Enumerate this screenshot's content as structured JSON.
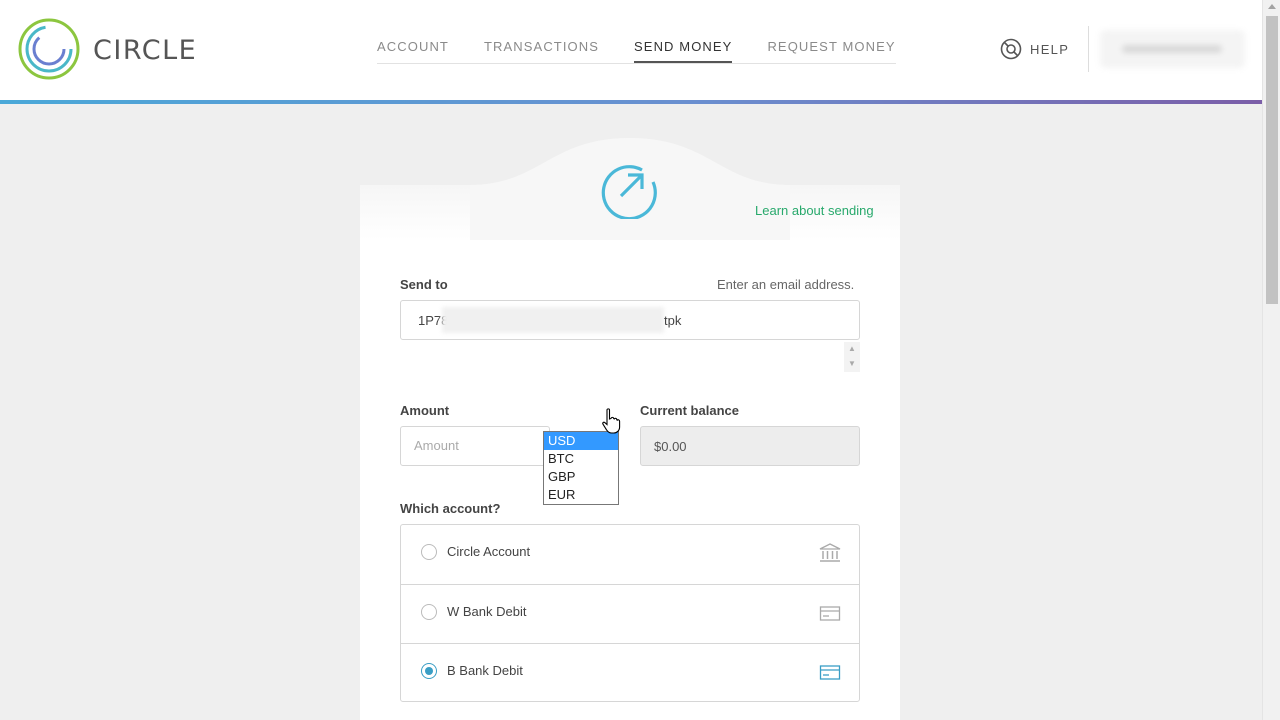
{
  "brand": {
    "name": "CIRCLE"
  },
  "nav": {
    "items": [
      {
        "label": "ACCOUNT",
        "active": false
      },
      {
        "label": "TRANSACTIONS",
        "active": false
      },
      {
        "label": "SEND MONEY",
        "active": true
      },
      {
        "label": "REQUEST MONEY",
        "active": false
      }
    ]
  },
  "help": {
    "label": "HELP"
  },
  "card": {
    "learn_link": "Learn about sending"
  },
  "send_to": {
    "label": "Send to",
    "hint": "Enter an email address.",
    "value_start": "1P78",
    "value_end": "tpk"
  },
  "amount": {
    "label": "Amount",
    "placeholder": "Amount",
    "currency_options": [
      "USD",
      "BTC",
      "GBP",
      "EUR"
    ],
    "currency_selected": "USD"
  },
  "balance": {
    "label": "Current balance",
    "value": "$0.00"
  },
  "accounts": {
    "label": "Which account?",
    "items": [
      {
        "label": "Circle Account",
        "icon": "bank-icon",
        "checked": false
      },
      {
        "label": "W Bank Debit",
        "icon": "card-icon",
        "checked": false
      },
      {
        "label": "B Bank Debit",
        "icon": "card-icon",
        "checked": true
      }
    ]
  },
  "colors": {
    "accent_green": "#28a96c",
    "accent_blue": "#3a9ec5",
    "selection_blue": "#3399ff"
  }
}
